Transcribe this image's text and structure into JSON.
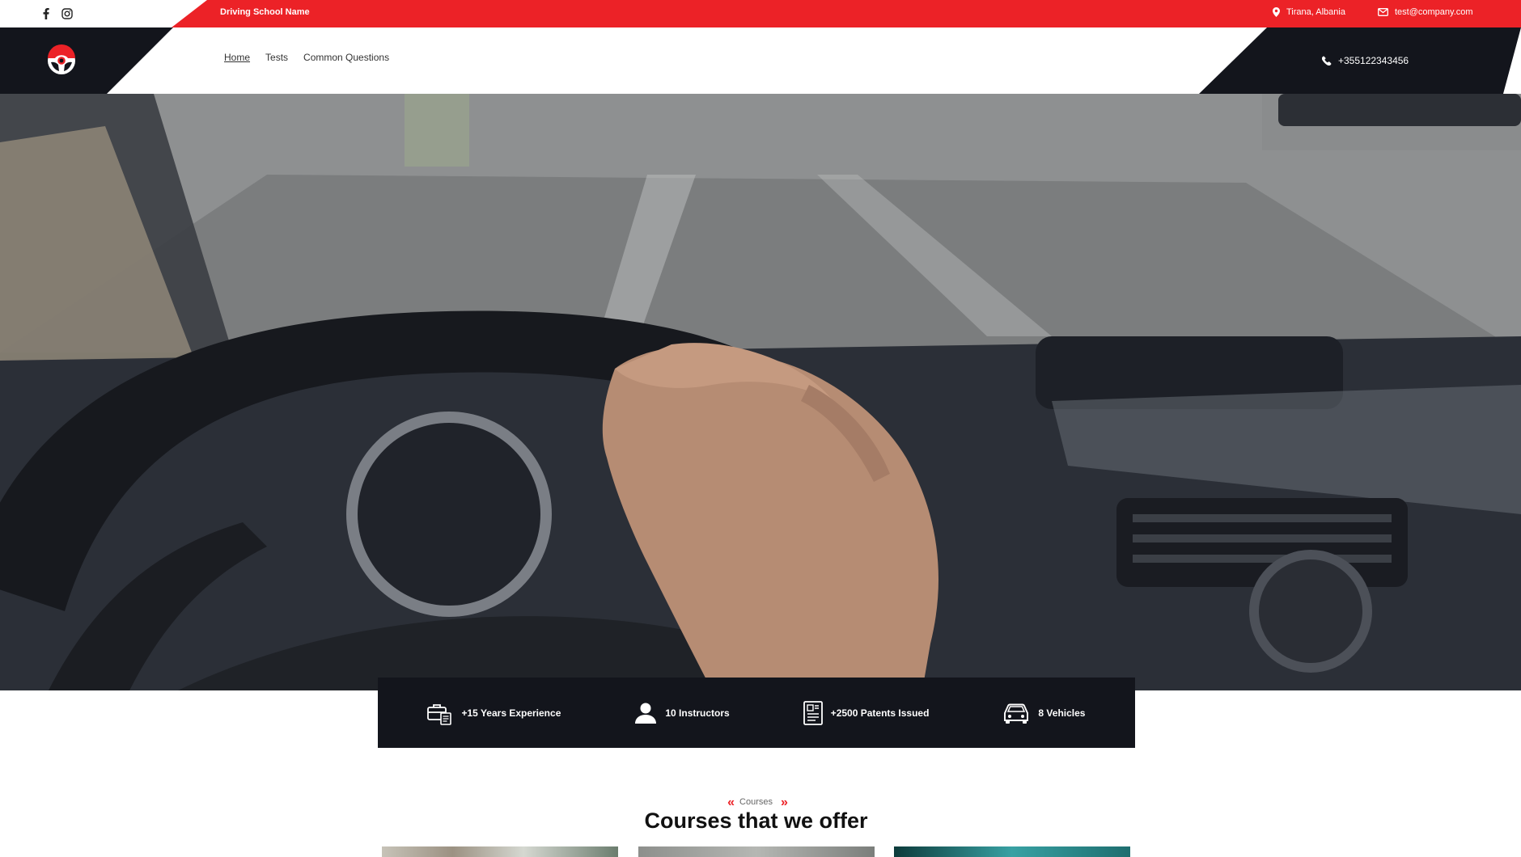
{
  "topbar": {
    "social": [
      {
        "name": "facebook-icon"
      },
      {
        "name": "instagram-icon"
      }
    ],
    "site_name": "Driving School Name",
    "location": "Tirana, Albania",
    "email": "test@company.com"
  },
  "header": {
    "nav": [
      {
        "label": "Home",
        "active": true
      },
      {
        "label": "Tests",
        "active": false
      },
      {
        "label": "Common Questions",
        "active": false
      }
    ],
    "phone": "+355122343456"
  },
  "stats": [
    {
      "icon": "briefcase-document-icon",
      "label": "+15 Years Experience"
    },
    {
      "icon": "person-icon",
      "label": "10 Instructors"
    },
    {
      "icon": "license-document-icon",
      "label": "+2500 Patents Issued"
    },
    {
      "icon": "car-icon",
      "label": "8 Vehicles"
    }
  ],
  "courses": {
    "eyebrow": "Courses",
    "title": "Courses that we offer"
  },
  "colors": {
    "accent": "#ec2227",
    "dark": "#13151c"
  }
}
